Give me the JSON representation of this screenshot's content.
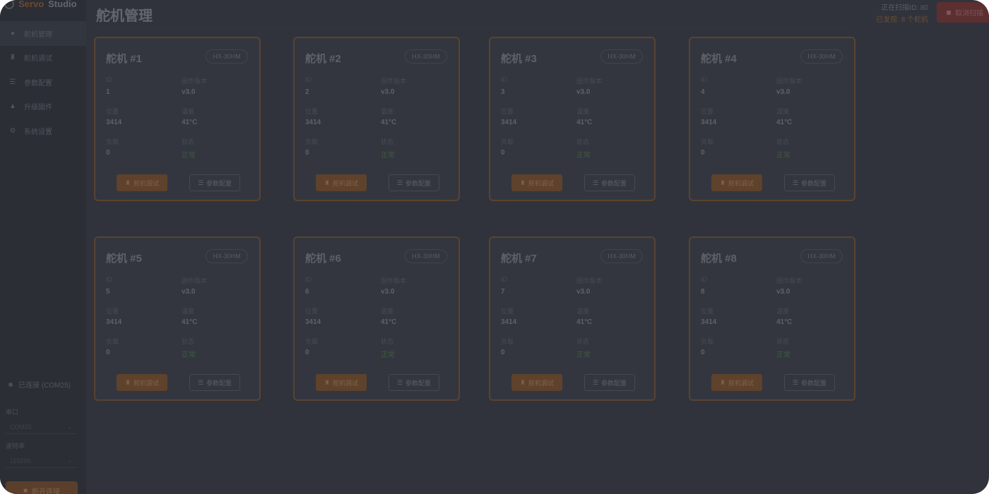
{
  "app": {
    "brand_part1": "Servo",
    "brand_part2": "Studio"
  },
  "page_title": "舵机管理",
  "sidebar": {
    "items": [
      {
        "label": "舵机管理",
        "icon": "servo-icon"
      },
      {
        "label": "舵机调试",
        "icon": "debug-icon"
      },
      {
        "label": "参数配置",
        "icon": "sliders-icon"
      },
      {
        "label": "升级固件",
        "icon": "upload-icon"
      },
      {
        "label": "系统设置",
        "icon": "gear-icon"
      }
    ],
    "connection_status": "已连接 (COM25)",
    "port_label": "串口",
    "port_value": "COM25",
    "baud_label": "波特率",
    "baud_value": "115200",
    "disconnect_label": "断开连接"
  },
  "header": {
    "scan_status": "正在扫描ID: 80",
    "found_status": "已发现: 8 个舵机",
    "stop_button": "取消扫描"
  },
  "labels": {
    "id": "ID",
    "firmware": "固件版本",
    "position": "位置",
    "temperature": "温度",
    "load": "负载",
    "status": "状态",
    "debug_button": "舵机调试",
    "config_button": "参数配置"
  },
  "servos": [
    {
      "title": "舵机 #1",
      "model": "HX-30HM",
      "id": "1",
      "firmware": "v3.0",
      "position": "3414",
      "temperature": "41°C",
      "load": "0",
      "status": "正常"
    },
    {
      "title": "舵机 #2",
      "model": "HX-30HM",
      "id": "2",
      "firmware": "v3.0",
      "position": "3414",
      "temperature": "41°C",
      "load": "0",
      "status": "正常"
    },
    {
      "title": "舵机 #3",
      "model": "HX-30HM",
      "id": "3",
      "firmware": "v3.0",
      "position": "3414",
      "temperature": "41°C",
      "load": "0",
      "status": "正常"
    },
    {
      "title": "舵机 #4",
      "model": "HX-30HM",
      "id": "4",
      "firmware": "v3.0",
      "position": "3414",
      "temperature": "41°C",
      "load": "0",
      "status": "正常"
    },
    {
      "title": "舵机 #5",
      "model": "HX-30HM",
      "id": "5",
      "firmware": "v3.0",
      "position": "3414",
      "temperature": "41°C",
      "load": "0",
      "status": "正常"
    },
    {
      "title": "舵机 #6",
      "model": "HX-30HM",
      "id": "6",
      "firmware": "v3.0",
      "position": "3414",
      "temperature": "41°C",
      "load": "0",
      "status": "正常"
    },
    {
      "title": "舵机 #7",
      "model": "HX-30HM",
      "id": "7",
      "firmware": "v3.0",
      "position": "3414",
      "temperature": "41°C",
      "load": "0",
      "status": "正常"
    },
    {
      "title": "舵机 #8",
      "model": "HX-30HM",
      "id": "8",
      "firmware": "v3.0",
      "position": "3414",
      "temperature": "41°C",
      "load": "0",
      "status": "正常"
    }
  ]
}
